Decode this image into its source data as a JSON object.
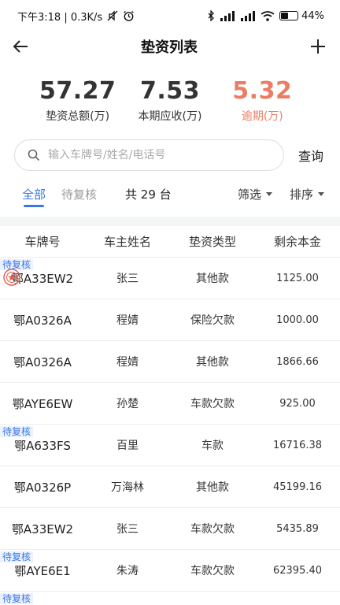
{
  "status_bar": {
    "time_speed": "下午3:18 | 0.3K/s",
    "battery": "44%"
  },
  "header": {
    "title": "垫资列表",
    "back_icon": "arrow-left-icon",
    "add_icon": "plus-icon"
  },
  "summary": {
    "total": {
      "value": "57.27",
      "label": "垫资总额(万)"
    },
    "receivable": {
      "value": "7.53",
      "label": "本期应收(万)"
    },
    "overdue": {
      "value": "5.32",
      "label": "逾期(万)"
    },
    "overdue_color": "#ea7d63"
  },
  "search": {
    "placeholder": "输入车牌号/姓名/电话号",
    "button": "查询"
  },
  "tabs": {
    "all": "全部",
    "pending": "待复核",
    "count": "共 29 台",
    "filter": "筛选",
    "sort": "排序",
    "accent": "#3b76e6"
  },
  "table": {
    "headers": [
      "车牌号",
      "车主姓名",
      "垫资类型",
      "剩余本金"
    ],
    "pending_tag": "待复核",
    "rows": [
      {
        "plate": "鄂A33EW2",
        "owner": "张三",
        "type": "其他款",
        "remaining": "1125.00"
      },
      {
        "plate": "鄂A0326A",
        "owner": "程婧",
        "type": "保险欠款",
        "remaining": "1000.00"
      },
      {
        "plate": "鄂A0326A",
        "owner": "程婧",
        "type": "其他款",
        "remaining": "1866.66"
      },
      {
        "plate": "鄂AYE6EW",
        "owner": "孙楚",
        "type": "车款欠款",
        "remaining": "925.00"
      },
      {
        "plate": "鄂A633FS",
        "owner": "百里",
        "type": "车款",
        "remaining": "16716.38"
      },
      {
        "plate": "鄂A0326P",
        "owner": "万海林",
        "type": "其他款",
        "remaining": "45199.16"
      },
      {
        "plate": "鄂A33EW2",
        "owner": "张三",
        "type": "车款欠款",
        "remaining": "5435.89"
      },
      {
        "plate": "鄂AYE6E1",
        "owner": "朱涛",
        "type": "车款欠款",
        "remaining": "62395.40"
      }
    ]
  }
}
